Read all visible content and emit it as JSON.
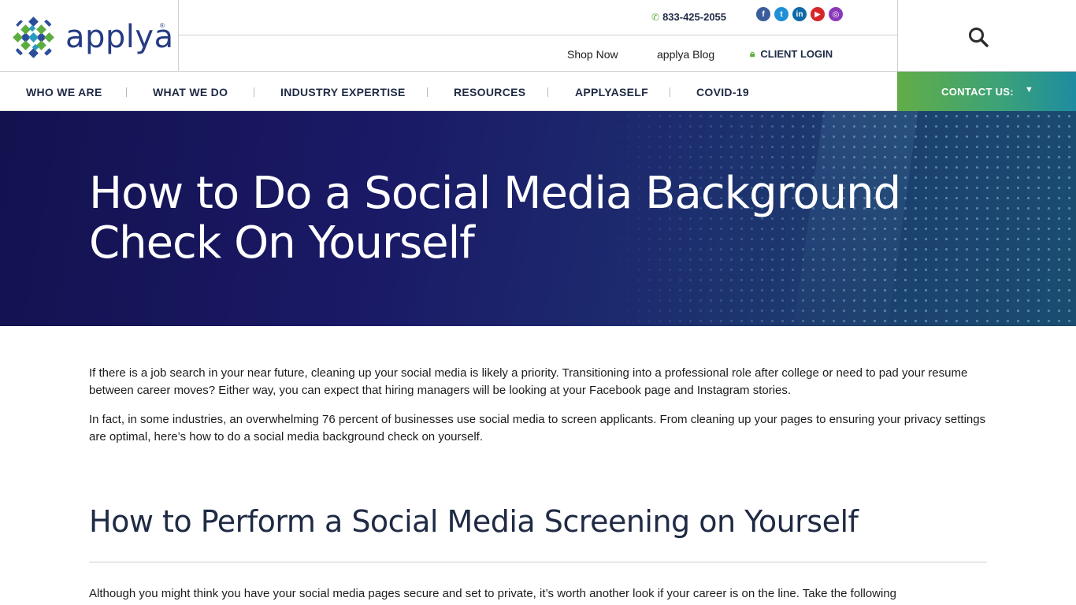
{
  "brand": {
    "name": "applya",
    "reg": "®"
  },
  "utility": {
    "phone": "833-425-2055",
    "socials": [
      {
        "name": "facebook",
        "glyph": "f"
      },
      {
        "name": "twitter",
        "glyph": "t"
      },
      {
        "name": "linkedin",
        "glyph": "in"
      },
      {
        "name": "youtube",
        "glyph": "▶"
      },
      {
        "name": "instagram",
        "glyph": "◎"
      }
    ]
  },
  "links": {
    "shop": "Shop Now",
    "blog": "applya Blog",
    "login": "CLIENT LOGIN"
  },
  "nav": {
    "items": [
      "WHO WE ARE",
      "WHAT WE DO",
      "INDUSTRY EXPERTISE",
      "RESOURCES",
      "APPLYASELF",
      "COVID-19"
    ]
  },
  "contact": {
    "label": "CONTACT US:",
    "caret": "▼"
  },
  "hero": {
    "title": "How to Do a Social Media Background Check On Yourself"
  },
  "article": {
    "p1": "If there is a job search in your near future, cleaning up your social media is likely a priority. Transitioning into a professional role after college or need to pad your resume between career moves? Either way, you can expect that hiring managers will be looking at your Facebook page and Instagram stories.",
    "p2": "In fact, in some industries, an overwhelming 76 percent of businesses use social media to screen applicants. From cleaning up your pages to ensuring your privacy settings are optimal, here’s how to do a social media background check on yourself.",
    "h2": "How to Perform a Social Media Screening on Yourself",
    "p3": "Although you might think you have your social media pages secure and set to private, it’s worth another look if your career is on the line. Take the following"
  },
  "colors": {
    "navy": "#1f2a44",
    "green": "#5cad3f",
    "brandBlue": "#263c82"
  }
}
